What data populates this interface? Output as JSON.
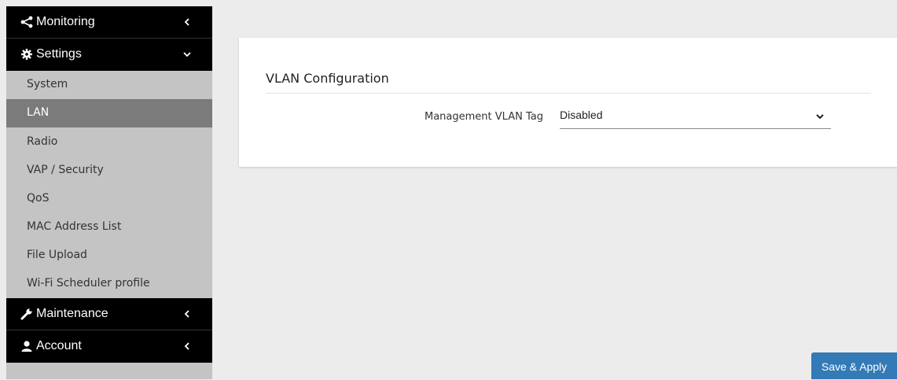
{
  "sidebar": {
    "monitoring": {
      "label": "Monitoring",
      "icon": "share-icon",
      "chevron": "chevron-left-icon"
    },
    "settings": {
      "label": "Settings",
      "icon": "gear-icon",
      "chevron": "chevron-down-icon",
      "items": [
        {
          "label": "System"
        },
        {
          "label": "LAN",
          "active": true
        },
        {
          "label": "Radio"
        },
        {
          "label": "VAP / Security"
        },
        {
          "label": "QoS"
        },
        {
          "label": "MAC Address List"
        },
        {
          "label": "File Upload"
        },
        {
          "label": "Wi-Fi Scheduler profile"
        }
      ]
    },
    "maintenance": {
      "label": "Maintenance",
      "icon": "wrench-icon",
      "chevron": "chevron-left-icon"
    },
    "account": {
      "label": "Account",
      "icon": "user-icon",
      "chevron": "chevron-left-icon"
    }
  },
  "main": {
    "card_title": "VLAN Configuration",
    "field_label": "Management VLAN Tag",
    "select_value": "Disabled"
  },
  "actions": {
    "save_apply": "Save & Apply"
  },
  "colors": {
    "active_item": "#7b7b7b",
    "button": "#337ab7",
    "sidebar": "#c4c4c4",
    "menu_head": "#000000"
  }
}
